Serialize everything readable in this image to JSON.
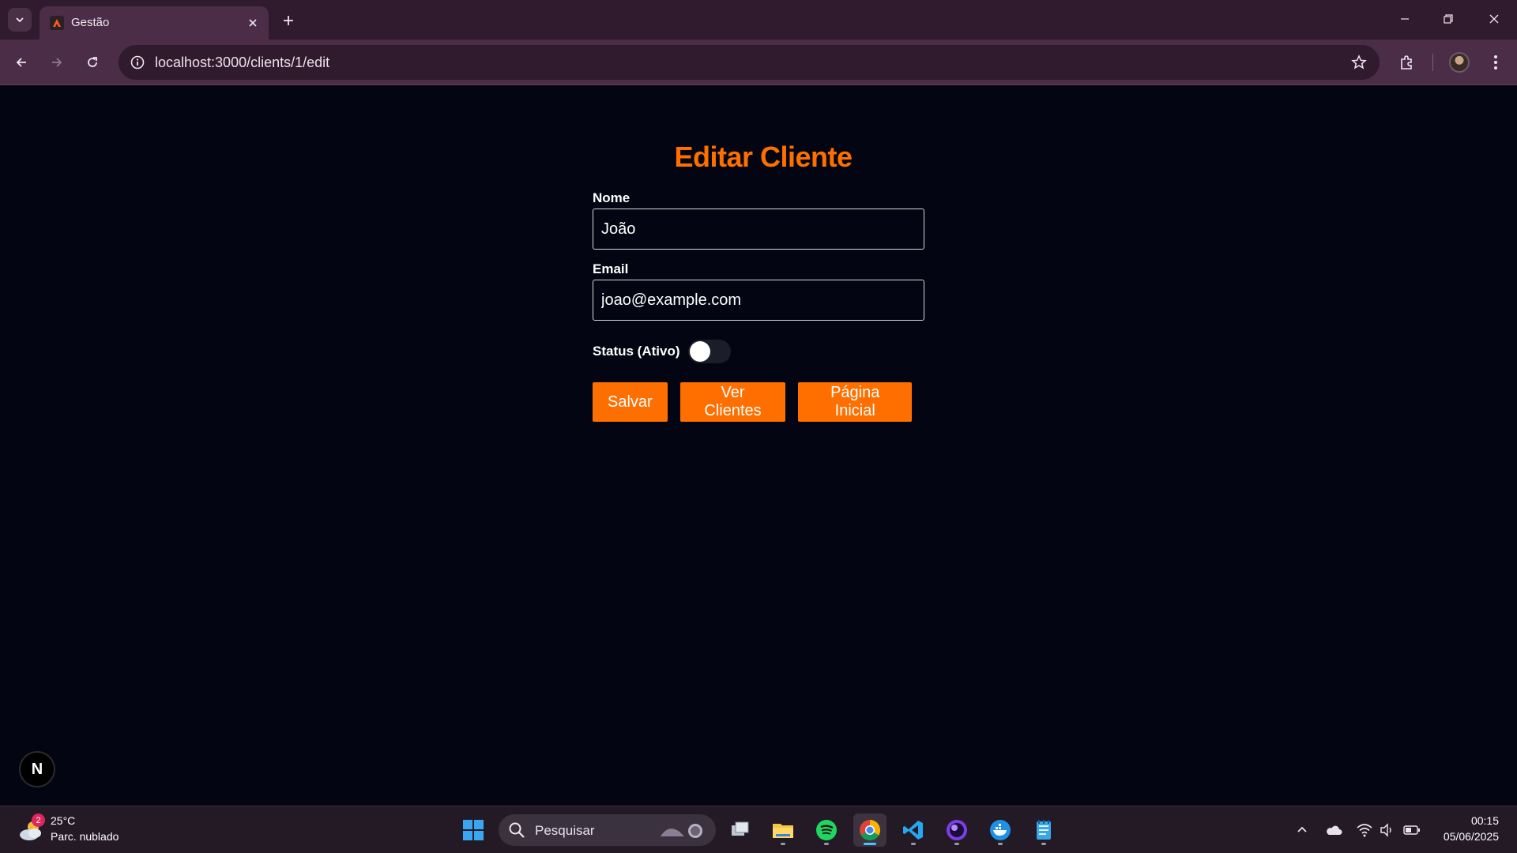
{
  "browser": {
    "tab": {
      "title": "Gestão"
    },
    "address_bar": {
      "url": "localhost:3000/clients/1/edit"
    }
  },
  "page": {
    "title": "Editar Cliente",
    "form": {
      "name_label": "Nome",
      "name_value": "João",
      "email_label": "Email",
      "email_value": "joao@example.com",
      "status_label": "Status (Ativo)",
      "status_active": false
    },
    "buttons": {
      "save": "Salvar",
      "view_clients": "Ver Clientes",
      "home": "Página Inicial"
    },
    "dev_badge": "N"
  },
  "taskbar": {
    "weather": {
      "temperature": "25°C",
      "description": "Parc. nublado",
      "badge_count": "2"
    },
    "search_placeholder": "Pesquisar",
    "apps": [
      "windows-start-icon",
      "task-view-icon",
      "file-explorer-icon",
      "spotify-icon",
      "chrome-icon",
      "vscode-icon",
      "app-purple-icon",
      "docker-icon",
      "notepad-icon"
    ],
    "clock": {
      "time": "00:15",
      "date": "05/06/2025"
    }
  },
  "colors": {
    "accent": "#ff6f00",
    "page_background": "#030612",
    "browser_frame": "#301a2d"
  }
}
